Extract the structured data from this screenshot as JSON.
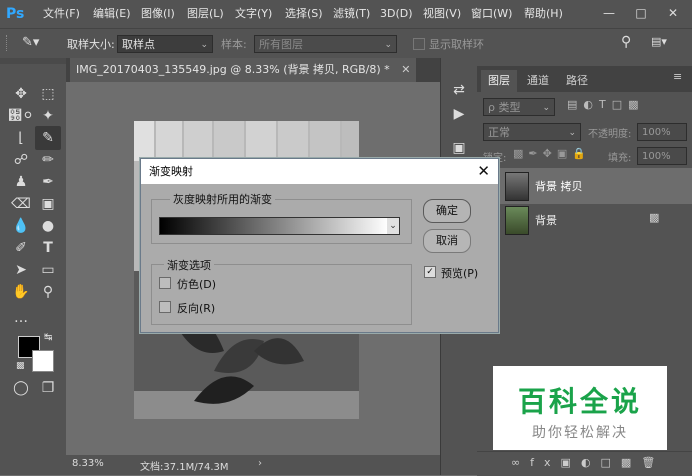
{
  "app": {
    "logo": "Ps"
  },
  "menu": [
    "文件(F)",
    "编辑(E)",
    "图像(I)",
    "图层(L)",
    "文字(Y)",
    "选择(S)",
    "滤镜(T)",
    "3D(D)",
    "视图(V)",
    "窗口(W)",
    "帮助(H)"
  ],
  "options": {
    "sample_size_label": "取样大小:",
    "sample_size_value": "取样点",
    "sample_label": "样本:",
    "sample_value": "所有图层",
    "show_ring_label": "显示取样环"
  },
  "document": {
    "tab_title": "IMG_20170403_135549.jpg @ 8.33% (背景 拷贝, RGB/8) *",
    "zoom": "8.33%",
    "doc_info": "文档:37.1M/74.3M"
  },
  "layers_panel": {
    "tabs": [
      "图层",
      "通道",
      "路径"
    ],
    "filter_label": "ρ 类型",
    "blend_mode": "正常",
    "opacity_label": "不透明度:",
    "opacity_value": "100%",
    "lock_label": "锁定:",
    "fill_label": "填充:",
    "fill_value": "100%",
    "layers": [
      {
        "name": "背景 拷贝"
      },
      {
        "name": "背景"
      }
    ]
  },
  "dialog": {
    "title": "渐变映射",
    "gradient_group": "灰度映射所用的渐变",
    "options_group": "渐变选项",
    "dither_label": "仿色(D)",
    "reverse_label": "反向(R)",
    "ok_label": "确定",
    "cancel_label": "取消",
    "preview_label": "预览(P)",
    "preview_checked": true,
    "dither_checked": false,
    "reverse_checked": false
  },
  "watermark": {
    "title": "百科全说",
    "subtitle": "助你轻松解决",
    "color": "#1aa34a"
  }
}
